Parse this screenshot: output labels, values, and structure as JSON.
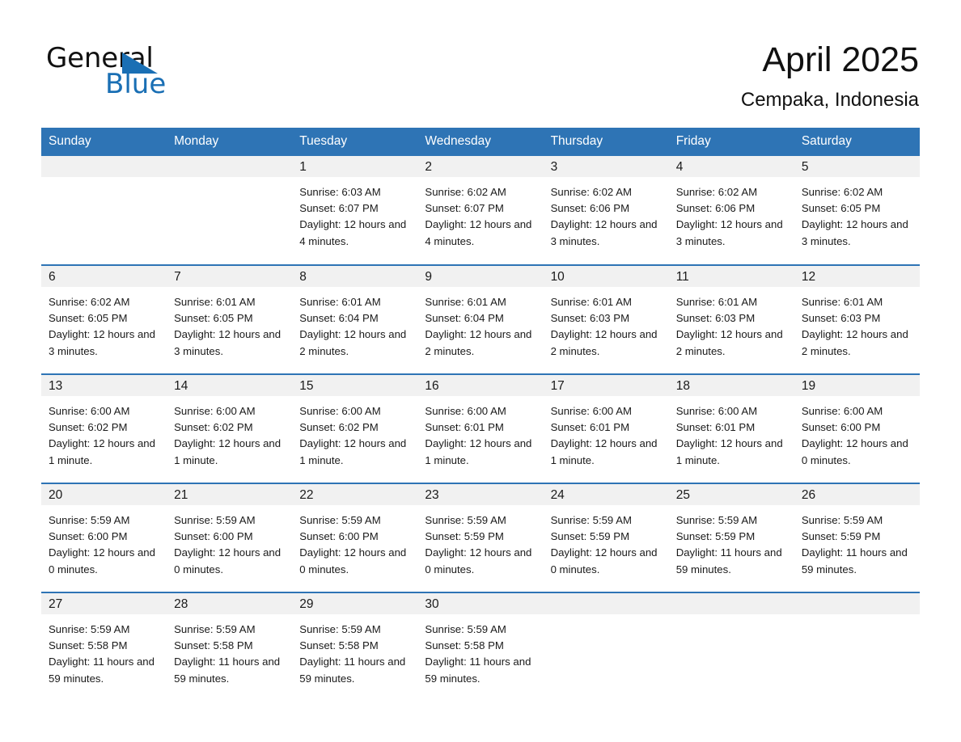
{
  "brand": {
    "name_part1": "General",
    "name_part2": "Blue",
    "triangle_color": "#1a6fb4"
  },
  "header": {
    "title": "April 2025",
    "location": "Cempaka, Indonesia"
  },
  "theme": {
    "header_blue": "#2e74b5",
    "daynum_band": "#f1f1f1",
    "text": "#1a1a1a"
  },
  "weekday_headers": [
    "Sunday",
    "Monday",
    "Tuesday",
    "Wednesday",
    "Thursday",
    "Friday",
    "Saturday"
  ],
  "weeks": [
    [
      {
        "day": "",
        "sunrise": "",
        "sunset": "",
        "daylight": ""
      },
      {
        "day": "",
        "sunrise": "",
        "sunset": "",
        "daylight": ""
      },
      {
        "day": "1",
        "sunrise": "Sunrise: 6:03 AM",
        "sunset": "Sunset: 6:07 PM",
        "daylight": "Daylight: 12 hours and 4 minutes."
      },
      {
        "day": "2",
        "sunrise": "Sunrise: 6:02 AM",
        "sunset": "Sunset: 6:07 PM",
        "daylight": "Daylight: 12 hours and 4 minutes."
      },
      {
        "day": "3",
        "sunrise": "Sunrise: 6:02 AM",
        "sunset": "Sunset: 6:06 PM",
        "daylight": "Daylight: 12 hours and 3 minutes."
      },
      {
        "day": "4",
        "sunrise": "Sunrise: 6:02 AM",
        "sunset": "Sunset: 6:06 PM",
        "daylight": "Daylight: 12 hours and 3 minutes."
      },
      {
        "day": "5",
        "sunrise": "Sunrise: 6:02 AM",
        "sunset": "Sunset: 6:05 PM",
        "daylight": "Daylight: 12 hours and 3 minutes."
      }
    ],
    [
      {
        "day": "6",
        "sunrise": "Sunrise: 6:02 AM",
        "sunset": "Sunset: 6:05 PM",
        "daylight": "Daylight: 12 hours and 3 minutes."
      },
      {
        "day": "7",
        "sunrise": "Sunrise: 6:01 AM",
        "sunset": "Sunset: 6:05 PM",
        "daylight": "Daylight: 12 hours and 3 minutes."
      },
      {
        "day": "8",
        "sunrise": "Sunrise: 6:01 AM",
        "sunset": "Sunset: 6:04 PM",
        "daylight": "Daylight: 12 hours and 2 minutes."
      },
      {
        "day": "9",
        "sunrise": "Sunrise: 6:01 AM",
        "sunset": "Sunset: 6:04 PM",
        "daylight": "Daylight: 12 hours and 2 minutes."
      },
      {
        "day": "10",
        "sunrise": "Sunrise: 6:01 AM",
        "sunset": "Sunset: 6:03 PM",
        "daylight": "Daylight: 12 hours and 2 minutes."
      },
      {
        "day": "11",
        "sunrise": "Sunrise: 6:01 AM",
        "sunset": "Sunset: 6:03 PM",
        "daylight": "Daylight: 12 hours and 2 minutes."
      },
      {
        "day": "12",
        "sunrise": "Sunrise: 6:01 AM",
        "sunset": "Sunset: 6:03 PM",
        "daylight": "Daylight: 12 hours and 2 minutes."
      }
    ],
    [
      {
        "day": "13",
        "sunrise": "Sunrise: 6:00 AM",
        "sunset": "Sunset: 6:02 PM",
        "daylight": "Daylight: 12 hours and 1 minute."
      },
      {
        "day": "14",
        "sunrise": "Sunrise: 6:00 AM",
        "sunset": "Sunset: 6:02 PM",
        "daylight": "Daylight: 12 hours and 1 minute."
      },
      {
        "day": "15",
        "sunrise": "Sunrise: 6:00 AM",
        "sunset": "Sunset: 6:02 PM",
        "daylight": "Daylight: 12 hours and 1 minute."
      },
      {
        "day": "16",
        "sunrise": "Sunrise: 6:00 AM",
        "sunset": "Sunset: 6:01 PM",
        "daylight": "Daylight: 12 hours and 1 minute."
      },
      {
        "day": "17",
        "sunrise": "Sunrise: 6:00 AM",
        "sunset": "Sunset: 6:01 PM",
        "daylight": "Daylight: 12 hours and 1 minute."
      },
      {
        "day": "18",
        "sunrise": "Sunrise: 6:00 AM",
        "sunset": "Sunset: 6:01 PM",
        "daylight": "Daylight: 12 hours and 1 minute."
      },
      {
        "day": "19",
        "sunrise": "Sunrise: 6:00 AM",
        "sunset": "Sunset: 6:00 PM",
        "daylight": "Daylight: 12 hours and 0 minutes."
      }
    ],
    [
      {
        "day": "20",
        "sunrise": "Sunrise: 5:59 AM",
        "sunset": "Sunset: 6:00 PM",
        "daylight": "Daylight: 12 hours and 0 minutes."
      },
      {
        "day": "21",
        "sunrise": "Sunrise: 5:59 AM",
        "sunset": "Sunset: 6:00 PM",
        "daylight": "Daylight: 12 hours and 0 minutes."
      },
      {
        "day": "22",
        "sunrise": "Sunrise: 5:59 AM",
        "sunset": "Sunset: 6:00 PM",
        "daylight": "Daylight: 12 hours and 0 minutes."
      },
      {
        "day": "23",
        "sunrise": "Sunrise: 5:59 AM",
        "sunset": "Sunset: 5:59 PM",
        "daylight": "Daylight: 12 hours and 0 minutes."
      },
      {
        "day": "24",
        "sunrise": "Sunrise: 5:59 AM",
        "sunset": "Sunset: 5:59 PM",
        "daylight": "Daylight: 12 hours and 0 minutes."
      },
      {
        "day": "25",
        "sunrise": "Sunrise: 5:59 AM",
        "sunset": "Sunset: 5:59 PM",
        "daylight": "Daylight: 11 hours and 59 minutes."
      },
      {
        "day": "26",
        "sunrise": "Sunrise: 5:59 AM",
        "sunset": "Sunset: 5:59 PM",
        "daylight": "Daylight: 11 hours and 59 minutes."
      }
    ],
    [
      {
        "day": "27",
        "sunrise": "Sunrise: 5:59 AM",
        "sunset": "Sunset: 5:58 PM",
        "daylight": "Daylight: 11 hours and 59 minutes."
      },
      {
        "day": "28",
        "sunrise": "Sunrise: 5:59 AM",
        "sunset": "Sunset: 5:58 PM",
        "daylight": "Daylight: 11 hours and 59 minutes."
      },
      {
        "day": "29",
        "sunrise": "Sunrise: 5:59 AM",
        "sunset": "Sunset: 5:58 PM",
        "daylight": "Daylight: 11 hours and 59 minutes."
      },
      {
        "day": "30",
        "sunrise": "Sunrise: 5:59 AM",
        "sunset": "Sunset: 5:58 PM",
        "daylight": "Daylight: 11 hours and 59 minutes."
      },
      {
        "day": "",
        "sunrise": "",
        "sunset": "",
        "daylight": ""
      },
      {
        "day": "",
        "sunrise": "",
        "sunset": "",
        "daylight": ""
      },
      {
        "day": "",
        "sunrise": "",
        "sunset": "",
        "daylight": ""
      }
    ]
  ]
}
